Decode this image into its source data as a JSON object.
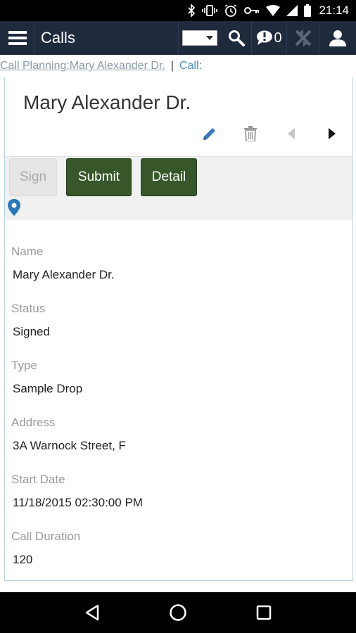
{
  "status_bar": {
    "time": "21:14",
    "icons": [
      "bluetooth-icon",
      "vibrate-icon",
      "alarm-icon",
      "key-icon",
      "wifi-icon",
      "signal-icon",
      "battery-icon"
    ]
  },
  "header": {
    "title": "Calls",
    "message_count": "0",
    "icons": [
      "menu-icon",
      "search-icon",
      "message-icon",
      "sync-icon",
      "user-icon"
    ],
    "bg_color": "#1f2a3d"
  },
  "breadcrumb": {
    "parent": "Call Planning:Mary Alexander Dr.",
    "separator": "|",
    "current": "Call:"
  },
  "record": {
    "title": "Mary Alexander Dr.",
    "actions": [
      "edit-icon",
      "delete-icon",
      "previous-icon",
      "next-icon"
    ],
    "buttons": {
      "sign": "Sign",
      "submit": "Submit",
      "detail": "Detail"
    },
    "accent_color": "#37572a",
    "fields": [
      {
        "label": "Name",
        "value": "Mary Alexander Dr."
      },
      {
        "label": "Status",
        "value": "Signed"
      },
      {
        "label": "Type",
        "value": "Sample Drop"
      },
      {
        "label": "Address",
        "value": "3A Warnock Street, F"
      },
      {
        "label": "Start Date",
        "value": "11/18/2015 02:30:00 PM"
      },
      {
        "label": "Call Duration",
        "value": "120"
      }
    ]
  },
  "nav_bar": {
    "icons": [
      "back-icon",
      "home-icon",
      "recents-icon"
    ]
  }
}
